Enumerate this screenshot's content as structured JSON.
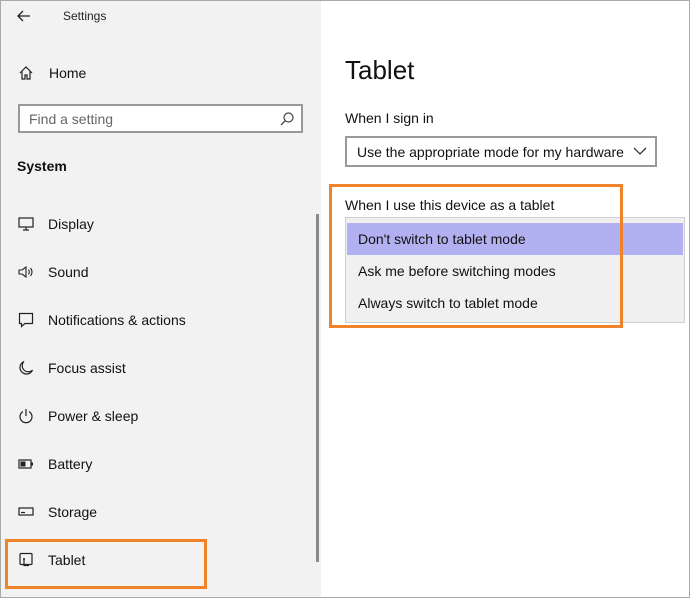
{
  "window": {
    "title": "Settings"
  },
  "sidebar": {
    "home_label": "Home",
    "search_placeholder": "Find a setting",
    "section_title": "System",
    "items": [
      {
        "label": "Display",
        "icon": "monitor-icon"
      },
      {
        "label": "Sound",
        "icon": "speaker-icon"
      },
      {
        "label": "Notifications & actions",
        "icon": "notification-icon"
      },
      {
        "label": "Focus assist",
        "icon": "moon-icon"
      },
      {
        "label": "Power & sleep",
        "icon": "power-icon"
      },
      {
        "label": "Battery",
        "icon": "battery-icon"
      },
      {
        "label": "Storage",
        "icon": "storage-icon"
      },
      {
        "label": "Tablet",
        "icon": "tablet-icon"
      }
    ],
    "selected_item": "Tablet"
  },
  "main": {
    "page_title": "Tablet",
    "sign_in_label": "When I sign in",
    "sign_in_value": "Use the appropriate mode for my hardware",
    "tablet_use_label": "When I use this device as a tablet",
    "tablet_use_options": [
      "Don't switch to tablet mode",
      "Ask me before switching modes",
      "Always switch to tablet mode"
    ],
    "tablet_use_selected": "Don't switch to tablet mode"
  },
  "colors": {
    "sidebar_bg": "#f2f2f2",
    "highlight_border": "#f0822a",
    "selected_option": "#b1b0f0"
  }
}
